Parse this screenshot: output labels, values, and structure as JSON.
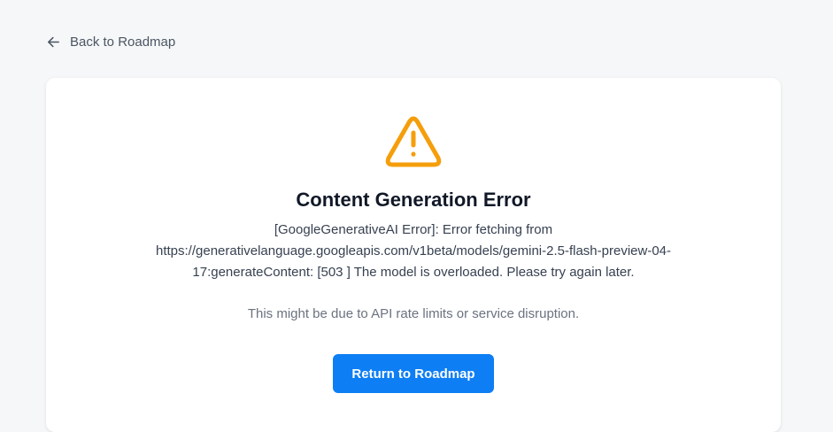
{
  "nav": {
    "back_label": "Back to Roadmap",
    "back_icon": "arrow-left-icon"
  },
  "error": {
    "icon": "warning-triangle-icon",
    "icon_color": "#f59e0b",
    "title": "Content Generation Error",
    "message": "[GoogleGenerativeAI Error]: Error fetching from https://generativelanguage.googleapis.com/v1beta/models/gemini-2.5-flash-preview-04-17:generateContent: [503 ] The model is overloaded. Please try again later.",
    "hint": "This might be due to API rate limits or service disruption."
  },
  "actions": {
    "return_label": "Return to Roadmap",
    "button_color": "#0d7ef4"
  }
}
